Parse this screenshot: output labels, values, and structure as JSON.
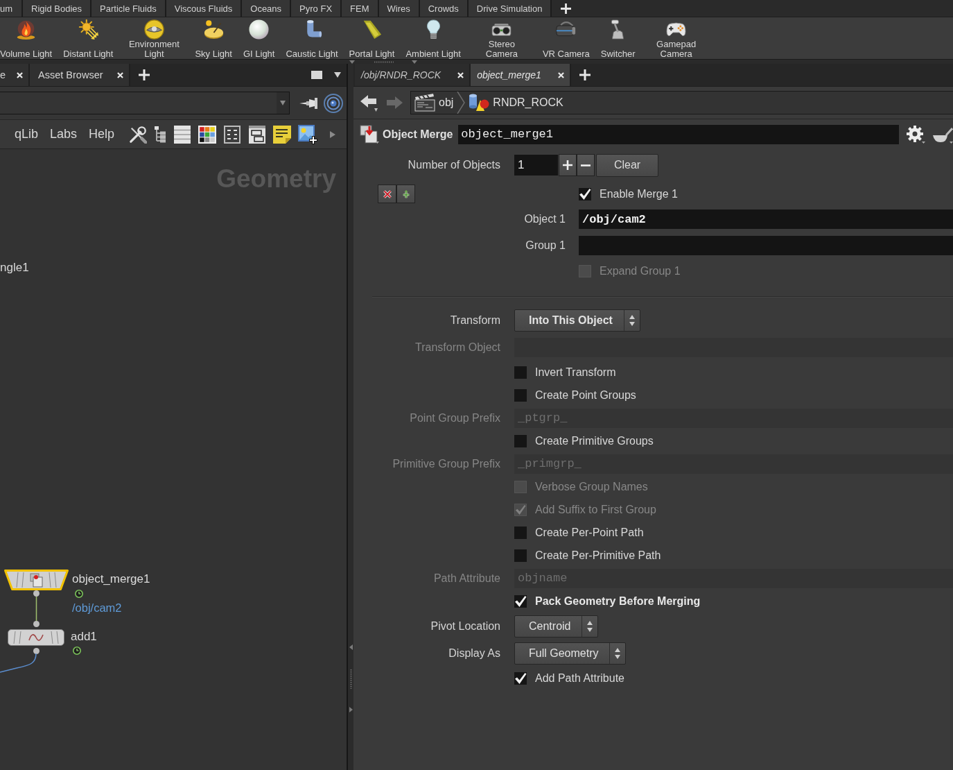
{
  "shelf_tabs": [
    {
      "label": "um"
    },
    {
      "label": "Rigid Bodies"
    },
    {
      "label": "Particle Fluids"
    },
    {
      "label": "Viscous Fluids"
    },
    {
      "label": "Oceans"
    },
    {
      "label": "Pyro FX"
    },
    {
      "label": "FEM"
    },
    {
      "label": "Wires"
    },
    {
      "label": "Crowds"
    },
    {
      "label": "Drive Simulation"
    }
  ],
  "shelf_tools": [
    {
      "label": "Volume Light"
    },
    {
      "label": "Distant Light"
    },
    {
      "label": "Environment\nLight"
    },
    {
      "label": "Sky Light"
    },
    {
      "label": "GI Light"
    },
    {
      "label": "Caustic Light"
    },
    {
      "label": "Portal Light"
    },
    {
      "label": "Ambient Light"
    },
    {
      "label": "Stereo\nCamera"
    },
    {
      "label": "VR Camera"
    },
    {
      "label": "Switcher"
    },
    {
      "label": "Gamepad\nCamera"
    }
  ],
  "left_pane": {
    "tabs": [
      {
        "label": "e"
      },
      {
        "label": "Asset Browser"
      }
    ],
    "menus": [
      {
        "label": "qLib"
      },
      {
        "label": "Labs"
      },
      {
        "label": "Help"
      }
    ],
    "network": {
      "title": "Geometry",
      "partial_label": "ngle1",
      "nodes": [
        {
          "kind": "object_merge",
          "name": "object_merge1",
          "comment": "/obj/cam2",
          "selected": true,
          "time_dependent": true
        },
        {
          "kind": "add",
          "name": "add1",
          "selected": false,
          "time_dependent": true
        }
      ]
    }
  },
  "right_pane": {
    "tabs": [
      {
        "label": "/obj/RNDR_ROCK",
        "selected": false
      },
      {
        "label": "object_merge1",
        "selected": true
      }
    ],
    "path": [
      {
        "label": "obj"
      },
      {
        "label": "RNDR_ROCK"
      }
    ],
    "node_type": "Object Merge",
    "node_name": "object_merge1",
    "parameters": [
      {
        "kind": "multiparm",
        "label": "Number of Objects",
        "value": "1",
        "disabled": false,
        "changed": false,
        "button": "Clear",
        "instances": [
          {
            "parameters": [
              {
                "kind": "toggle",
                "label": "Enable Merge 1",
                "checked": true,
                "disabled": false,
                "changed": false
              },
              {
                "kind": "path",
                "label": "Object 1",
                "value": "/obj/cam2",
                "disabled": false,
                "changed": true
              },
              {
                "kind": "text",
                "label": "Group 1",
                "disabled": false
              },
              {
                "kind": "toggle",
                "label": "Expand Group 1",
                "checked": false,
                "disabled": true,
                "changed": false
              }
            ]
          }
        ]
      },
      {
        "kind": "separator"
      },
      {
        "kind": "menu",
        "label": "Transform",
        "value": "Into This Object",
        "disabled": false,
        "changed": true
      },
      {
        "kind": "path",
        "label": "Transform Object",
        "disabled": true
      },
      {
        "kind": "toggle",
        "label": "Invert Transform",
        "checked": false,
        "disabled": false,
        "changed": false
      },
      {
        "kind": "toggle",
        "label": "Create Point Groups",
        "checked": false,
        "disabled": false,
        "changed": false
      },
      {
        "kind": "text",
        "label": "Point Group Prefix",
        "value": "_ptgrp_",
        "disabled": true,
        "changed": false
      },
      {
        "kind": "toggle",
        "label": "Create Primitive Groups",
        "checked": false,
        "disabled": false,
        "changed": false
      },
      {
        "kind": "text",
        "label": "Primitive Group Prefix",
        "value": "_primgrp_",
        "disabled": true,
        "changed": false
      },
      {
        "kind": "toggle",
        "label": "Verbose Group Names",
        "checked": false,
        "disabled": true,
        "changed": false
      },
      {
        "kind": "toggle",
        "label": "Add Suffix to First Group",
        "checked": true,
        "disabled": true,
        "changed": false
      },
      {
        "kind": "toggle",
        "label": "Create Per-Point Path",
        "checked": false,
        "disabled": false,
        "changed": false
      },
      {
        "kind": "toggle",
        "label": "Create Per-Primitive Path",
        "checked": false,
        "disabled": false,
        "changed": false
      },
      {
        "kind": "text",
        "label": "Path Attribute",
        "value": "objname",
        "disabled": true,
        "changed": false
      },
      {
        "kind": "toggle",
        "label": "Pack Geometry Before Merging",
        "checked": true,
        "disabled": false,
        "changed": true
      },
      {
        "kind": "menu",
        "label": "Pivot Location",
        "value": "Centroid",
        "disabled": false,
        "changed": false
      },
      {
        "kind": "menu",
        "label": "Display As",
        "value": "Full Geometry",
        "disabled": false,
        "changed": false
      },
      {
        "kind": "toggle",
        "label": "Add Path Attribute",
        "checked": true,
        "disabled": false,
        "changed": false
      }
    ]
  }
}
